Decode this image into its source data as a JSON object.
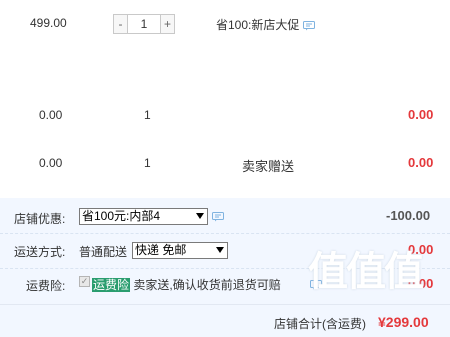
{
  "items": [
    {
      "price": "499.00",
      "quantity": "1",
      "promo": "省100:新店大促",
      "total": ""
    },
    {
      "price": "0.00",
      "quantity": "1",
      "promo": "",
      "total": "0.00"
    },
    {
      "price": "0.00",
      "quantity": "1",
      "promo": "卖家赠送",
      "total": "0.00"
    }
  ],
  "stepper": {
    "minus": "-",
    "plus": "+"
  },
  "footer": {
    "discount_label": "店铺优惠:",
    "discount_select": "省100元:内部4",
    "discount_value": "-100.00",
    "shipping_label": "运送方式:",
    "shipping_method": "普通配送",
    "shipping_select": "快递 免邮",
    "shipping_value": "0.00",
    "insurance_label": "运费险:",
    "insurance_tag": "运费险",
    "insurance_desc": "卖家送,确认收货前退货可赔",
    "insurance_value": "0.00",
    "total_label": "店铺合计(含运费)",
    "total_value": "¥299.00"
  },
  "watermark_text": "值值值",
  "colors": {
    "price_red": "#e4393c",
    "footer_bg": "#f2f7ff",
    "tag_green": "#2a9d6f",
    "icon_blue": "#7fb3e0"
  }
}
